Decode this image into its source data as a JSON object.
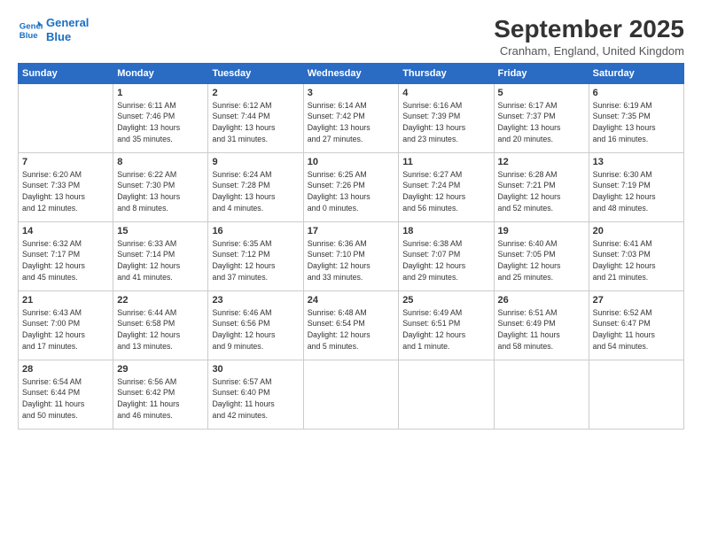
{
  "header": {
    "logo_line1": "General",
    "logo_line2": "Blue",
    "title": "September 2025",
    "subtitle": "Cranham, England, United Kingdom"
  },
  "weekdays": [
    "Sunday",
    "Monday",
    "Tuesday",
    "Wednesday",
    "Thursday",
    "Friday",
    "Saturday"
  ],
  "weeks": [
    [
      {
        "day": "",
        "info": ""
      },
      {
        "day": "1",
        "info": "Sunrise: 6:11 AM\nSunset: 7:46 PM\nDaylight: 13 hours\nand 35 minutes."
      },
      {
        "day": "2",
        "info": "Sunrise: 6:12 AM\nSunset: 7:44 PM\nDaylight: 13 hours\nand 31 minutes."
      },
      {
        "day": "3",
        "info": "Sunrise: 6:14 AM\nSunset: 7:42 PM\nDaylight: 13 hours\nand 27 minutes."
      },
      {
        "day": "4",
        "info": "Sunrise: 6:16 AM\nSunset: 7:39 PM\nDaylight: 13 hours\nand 23 minutes."
      },
      {
        "day": "5",
        "info": "Sunrise: 6:17 AM\nSunset: 7:37 PM\nDaylight: 13 hours\nand 20 minutes."
      },
      {
        "day": "6",
        "info": "Sunrise: 6:19 AM\nSunset: 7:35 PM\nDaylight: 13 hours\nand 16 minutes."
      }
    ],
    [
      {
        "day": "7",
        "info": "Sunrise: 6:20 AM\nSunset: 7:33 PM\nDaylight: 13 hours\nand 12 minutes."
      },
      {
        "day": "8",
        "info": "Sunrise: 6:22 AM\nSunset: 7:30 PM\nDaylight: 13 hours\nand 8 minutes."
      },
      {
        "day": "9",
        "info": "Sunrise: 6:24 AM\nSunset: 7:28 PM\nDaylight: 13 hours\nand 4 minutes."
      },
      {
        "day": "10",
        "info": "Sunrise: 6:25 AM\nSunset: 7:26 PM\nDaylight: 13 hours\nand 0 minutes."
      },
      {
        "day": "11",
        "info": "Sunrise: 6:27 AM\nSunset: 7:24 PM\nDaylight: 12 hours\nand 56 minutes."
      },
      {
        "day": "12",
        "info": "Sunrise: 6:28 AM\nSunset: 7:21 PM\nDaylight: 12 hours\nand 52 minutes."
      },
      {
        "day": "13",
        "info": "Sunrise: 6:30 AM\nSunset: 7:19 PM\nDaylight: 12 hours\nand 48 minutes."
      }
    ],
    [
      {
        "day": "14",
        "info": "Sunrise: 6:32 AM\nSunset: 7:17 PM\nDaylight: 12 hours\nand 45 minutes."
      },
      {
        "day": "15",
        "info": "Sunrise: 6:33 AM\nSunset: 7:14 PM\nDaylight: 12 hours\nand 41 minutes."
      },
      {
        "day": "16",
        "info": "Sunrise: 6:35 AM\nSunset: 7:12 PM\nDaylight: 12 hours\nand 37 minutes."
      },
      {
        "day": "17",
        "info": "Sunrise: 6:36 AM\nSunset: 7:10 PM\nDaylight: 12 hours\nand 33 minutes."
      },
      {
        "day": "18",
        "info": "Sunrise: 6:38 AM\nSunset: 7:07 PM\nDaylight: 12 hours\nand 29 minutes."
      },
      {
        "day": "19",
        "info": "Sunrise: 6:40 AM\nSunset: 7:05 PM\nDaylight: 12 hours\nand 25 minutes."
      },
      {
        "day": "20",
        "info": "Sunrise: 6:41 AM\nSunset: 7:03 PM\nDaylight: 12 hours\nand 21 minutes."
      }
    ],
    [
      {
        "day": "21",
        "info": "Sunrise: 6:43 AM\nSunset: 7:00 PM\nDaylight: 12 hours\nand 17 minutes."
      },
      {
        "day": "22",
        "info": "Sunrise: 6:44 AM\nSunset: 6:58 PM\nDaylight: 12 hours\nand 13 minutes."
      },
      {
        "day": "23",
        "info": "Sunrise: 6:46 AM\nSunset: 6:56 PM\nDaylight: 12 hours\nand 9 minutes."
      },
      {
        "day": "24",
        "info": "Sunrise: 6:48 AM\nSunset: 6:54 PM\nDaylight: 12 hours\nand 5 minutes."
      },
      {
        "day": "25",
        "info": "Sunrise: 6:49 AM\nSunset: 6:51 PM\nDaylight: 12 hours\nand 1 minute."
      },
      {
        "day": "26",
        "info": "Sunrise: 6:51 AM\nSunset: 6:49 PM\nDaylight: 11 hours\nand 58 minutes."
      },
      {
        "day": "27",
        "info": "Sunrise: 6:52 AM\nSunset: 6:47 PM\nDaylight: 11 hours\nand 54 minutes."
      }
    ],
    [
      {
        "day": "28",
        "info": "Sunrise: 6:54 AM\nSunset: 6:44 PM\nDaylight: 11 hours\nand 50 minutes."
      },
      {
        "day": "29",
        "info": "Sunrise: 6:56 AM\nSunset: 6:42 PM\nDaylight: 11 hours\nand 46 minutes."
      },
      {
        "day": "30",
        "info": "Sunrise: 6:57 AM\nSunset: 6:40 PM\nDaylight: 11 hours\nand 42 minutes."
      },
      {
        "day": "",
        "info": ""
      },
      {
        "day": "",
        "info": ""
      },
      {
        "day": "",
        "info": ""
      },
      {
        "day": "",
        "info": ""
      }
    ]
  ]
}
